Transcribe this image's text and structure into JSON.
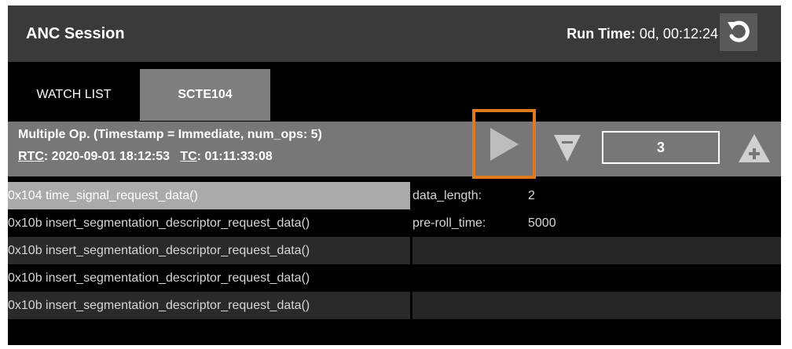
{
  "app": {
    "title": "ANC Session",
    "run_time_label": "Run Time:",
    "run_time_value": "0d, 00:12:24",
    "reset_icon": "reset-icon"
  },
  "tabs": [
    {
      "label": "WATCH LIST",
      "active": false
    },
    {
      "label": "SCTE104",
      "active": true
    }
  ],
  "operation": {
    "line1": "Multiple Op. (Timestamp = Immediate, num_ops: 5)",
    "rtc_label": "RTC",
    "rtc_value": ": 2020-09-01 18:12:53",
    "tc_label": "TC",
    "tc_value": ": 01:11:33:08",
    "op_number": "3",
    "highlight_color": "#e07a1f"
  },
  "rows": [
    {
      "command": "0x104 time_signal_request_data()",
      "key": "data_length:",
      "value": "2"
    },
    {
      "command": "0x10b insert_segmentation_descriptor_request_data()",
      "key": "pre-roll_time:",
      "value": "5000"
    },
    {
      "command": "0x10b insert_segmentation_descriptor_request_data()",
      "key": "",
      "value": ""
    },
    {
      "command": "0x10b insert_segmentation_descriptor_request_data()",
      "key": "",
      "value": ""
    },
    {
      "command": "0x10b insert_segmentation_descriptor_request_data()",
      "key": "",
      "value": ""
    }
  ]
}
